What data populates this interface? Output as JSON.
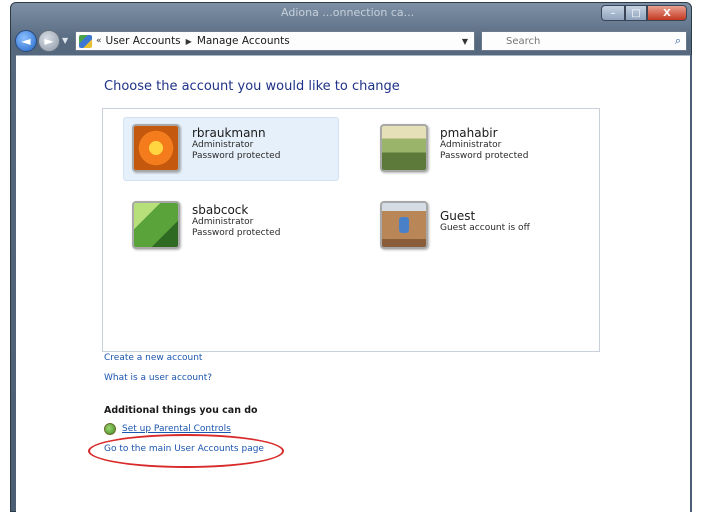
{
  "window": {
    "title_hint": "Adiona ...onnection ca..."
  },
  "titlebar_buttons": {
    "minimize": "–",
    "maximize": "□",
    "close": "X"
  },
  "nav": {
    "back_glyph": "◄",
    "forward_glyph": "►",
    "recent_glyph": "▼"
  },
  "address": {
    "chevron": "«",
    "crumbs": [
      "User Accounts",
      "Manage Accounts"
    ],
    "separator": "▶",
    "dropdown": "▼"
  },
  "refresh_glyph": "↻",
  "search": {
    "placeholder": "Search"
  },
  "main": {
    "heading": "Choose the account you would like to change",
    "accounts": [
      {
        "name": "rbraukmann",
        "details": [
          "Administrator",
          "Password protected"
        ],
        "picture": "flower"
      },
      {
        "name": "pmahabir",
        "details": [
          "Administrator",
          "Password protected"
        ],
        "picture": "landscape"
      },
      {
        "name": "sbabcock",
        "details": [
          "Administrator",
          "Password protected"
        ],
        "picture": "leaf"
      },
      {
        "name": "Guest",
        "details": [
          "Guest account is off"
        ],
        "picture": "guest"
      }
    ],
    "links": {
      "create_account": "Create a new account",
      "what_is_account": "What is a user account?"
    },
    "additional": {
      "heading": "Additional things you can do",
      "parental_controls": "Set up Parental Controls",
      "main_page": "Go to the main User Accounts page"
    }
  },
  "colors": {
    "link": "#1c56b0",
    "heading": "#1e3287",
    "annotation_circle": "#d82a2a"
  }
}
